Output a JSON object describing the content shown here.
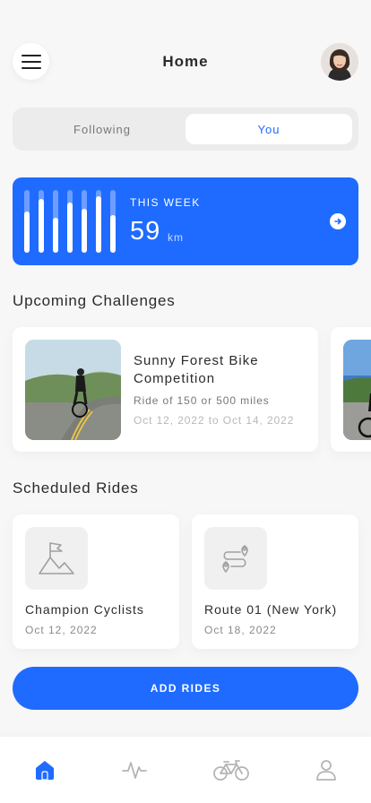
{
  "header": {
    "title": "Home",
    "menu_icon": "hamburger-menu-icon",
    "avatar": "user-avatar"
  },
  "segment": {
    "tabs": [
      {
        "label": "Following",
        "active": false
      },
      {
        "label": "You",
        "active": true
      }
    ]
  },
  "week_summary": {
    "label": "THIS WEEK",
    "value": "59",
    "unit": "km",
    "bar_levels": [
      0.65,
      0.85,
      0.55,
      0.8,
      0.7,
      0.9,
      0.6
    ],
    "arrow_icon": "arrow-right-icon",
    "color": "#1f6bff"
  },
  "challenges": {
    "title": "Upcoming Challenges",
    "items": [
      {
        "name": "Sunny Forest Bike Competition",
        "description": "Ride of 150 or 500 miles",
        "dates": "Oct 12, 2022 to Oct 14, 2022"
      }
    ]
  },
  "rides": {
    "title": "Scheduled Rides",
    "items": [
      {
        "name": "Champion Cyclists",
        "date": "Oct 12, 2022",
        "icon": "mountain-flag-icon"
      },
      {
        "name": "Route 01 (New York)",
        "date": "Oct 18, 2022",
        "icon": "route-icon"
      }
    ]
  },
  "actions": {
    "add_rides_label": "ADD RIDES"
  },
  "tabbar": {
    "items": [
      "home-icon",
      "activity-icon",
      "bike-icon",
      "profile-icon"
    ],
    "active": "home-icon",
    "accent": "#1f6bff",
    "inactive": "#b5b5b5"
  }
}
